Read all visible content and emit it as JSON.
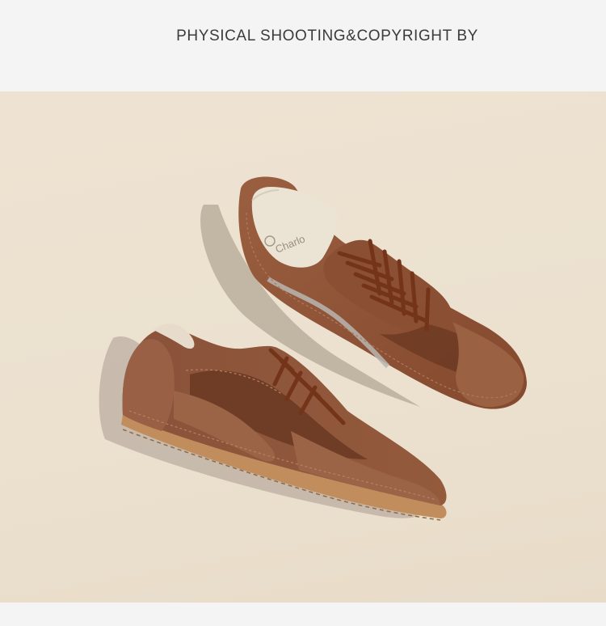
{
  "header": {
    "caption": "PHYSICAL SHOOTING&COPYRIGHT BY"
  },
  "photo": {
    "subject": "brown-suede-sneakers",
    "insole_print": "Charlo",
    "colors": {
      "backdrop": "#ece1cf",
      "suede": "#8e553a",
      "suede_dark": "#6e3b24",
      "laces": "#7a3a1f",
      "sole": "#c08a5b",
      "insole": "#eae2d2"
    }
  }
}
